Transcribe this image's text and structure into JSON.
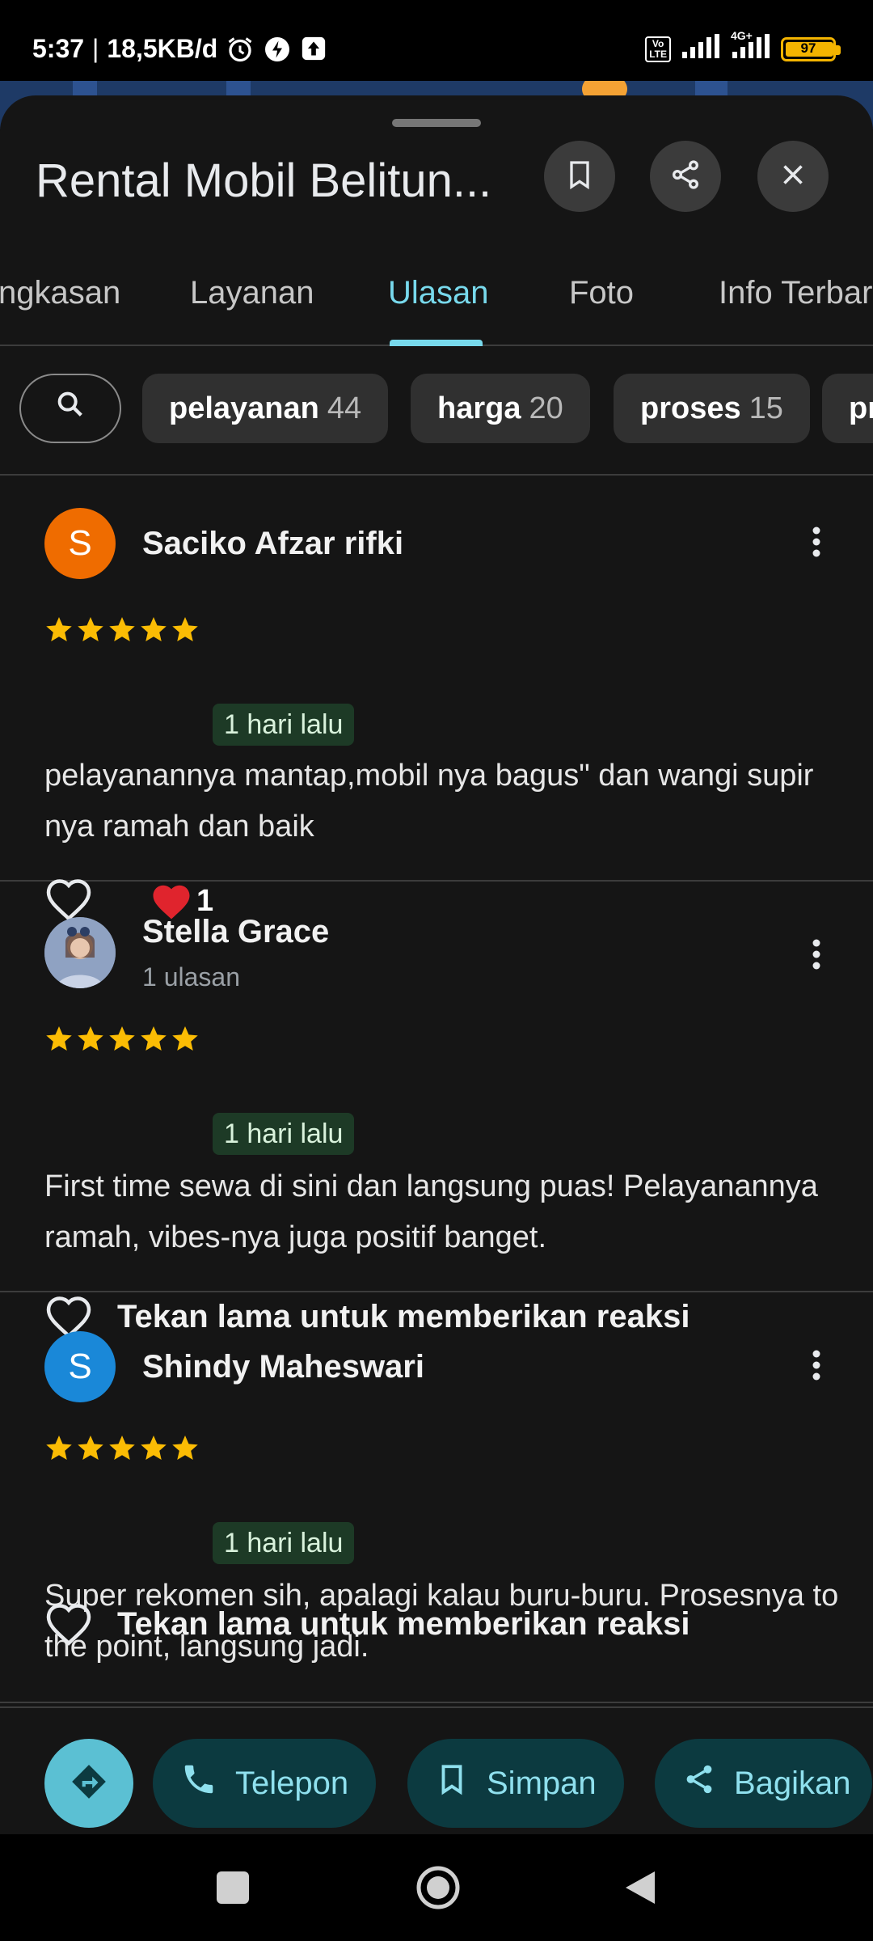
{
  "status_bar": {
    "time": "5:37",
    "net_speed": "18,5KB/d",
    "network_type": "4G+",
    "volte": "Vo LTE",
    "battery_level": "97"
  },
  "place": {
    "title": "Rental Mobil Belitun..."
  },
  "tabs": [
    {
      "label": "ngkasan"
    },
    {
      "label": "Layanan"
    },
    {
      "label": "Ulasan"
    },
    {
      "label": "Foto"
    },
    {
      "label": "Info Terbar"
    }
  ],
  "active_tab": "Ulasan",
  "chips": [
    {
      "label": "pelayanan",
      "count": "44"
    },
    {
      "label": "harga",
      "count": "20"
    },
    {
      "label": "proses",
      "count": "15"
    },
    {
      "label": "pr",
      "count": ""
    }
  ],
  "reviews": [
    {
      "initial": "S",
      "avatar_color": "#ef6c00",
      "name": "Saciko Afzar rifki",
      "meta": "",
      "rating": 5,
      "date": "1 hari lalu",
      "text": "pelayanannya mantap,mobil nya bagus\" dan wangi supir nya ramah dan baik",
      "reaction_count": "1",
      "like_prompt": ""
    },
    {
      "initial": "",
      "avatar_color": "#6b7f9e",
      "name": "Stella Grace",
      "meta": "1 ulasan",
      "rating": 5,
      "date": "1 hari lalu",
      "text": "First time sewa di sini dan langsung puas! Pelayanannya ramah, vibes-nya juga positif banget.",
      "reaction_count": "",
      "like_prompt": "Tekan lama untuk memberikan reaksi"
    },
    {
      "initial": "S",
      "avatar_color": "#1a88d8",
      "name": "Shindy Maheswari",
      "meta": "",
      "rating": 5,
      "date": "1 hari lalu",
      "text": "Super rekomen sih, apalagi kalau buru-buru. Prosesnya to the point, langsung jadi.",
      "reaction_count": "",
      "like_prompt": "Tekan lama untuk memberikan reaksi"
    }
  ],
  "actions": {
    "call": "Telepon",
    "save": "Simpan",
    "share": "Bagikan"
  },
  "colors": {
    "accent": "#78d9ec",
    "star": "#fbbc04",
    "badge_bg": "#1d3a26",
    "action_pill": "#0c3a40",
    "directions": "#5bc0d3"
  }
}
